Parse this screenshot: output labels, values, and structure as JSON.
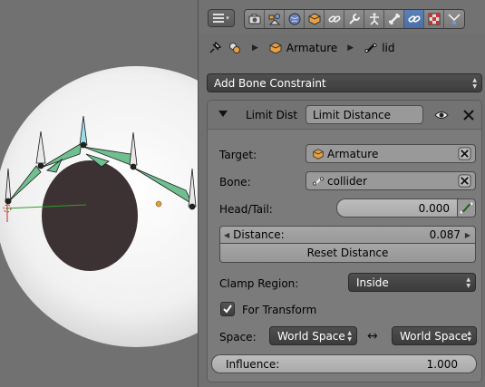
{
  "header": {
    "active_tab": "bone-constraints",
    "tabs": [
      "render",
      "scene",
      "world",
      "object",
      "object-constraints",
      "modifiers",
      "object-data",
      "bone",
      "bone-constraints",
      "material",
      "texture"
    ]
  },
  "breadcrumb": {
    "items": [
      {
        "icon": "mesh-icon",
        "label": ""
      },
      {
        "icon": "armature-icon",
        "label": "Armature"
      },
      {
        "icon": "bone-icon",
        "label": "lid"
      }
    ]
  },
  "add_constraint": {
    "label": "Add Bone Constraint"
  },
  "constraint": {
    "type_label": "Limit Dist",
    "name": "Limit Distance",
    "target": {
      "label": "Target:",
      "value": "Armature"
    },
    "bone": {
      "label": "Bone:",
      "value": "collider"
    },
    "head_tail": {
      "label": "Head/Tail:",
      "value": "0.000"
    },
    "distance": {
      "label": "Distance:",
      "value": "0.087"
    },
    "reset_label": "Reset Distance",
    "clamp_region": {
      "label": "Clamp Region:",
      "value": "Inside"
    },
    "for_transform": {
      "label": "For Transform",
      "checked": true
    },
    "space": {
      "label": "Space:",
      "owner": "World Space",
      "target": "World Space"
    },
    "influence": {
      "label": "Influence:",
      "value": "1.000"
    }
  },
  "colors": {
    "panel_bg": "#707070",
    "box_bg": "#7b7b7b",
    "field_bg": "#999999",
    "active_tab": "#5b80b8",
    "bone_green": "#6fbf90",
    "eye_white": "#f2f2f2",
    "pupil": "#3d3233"
  }
}
